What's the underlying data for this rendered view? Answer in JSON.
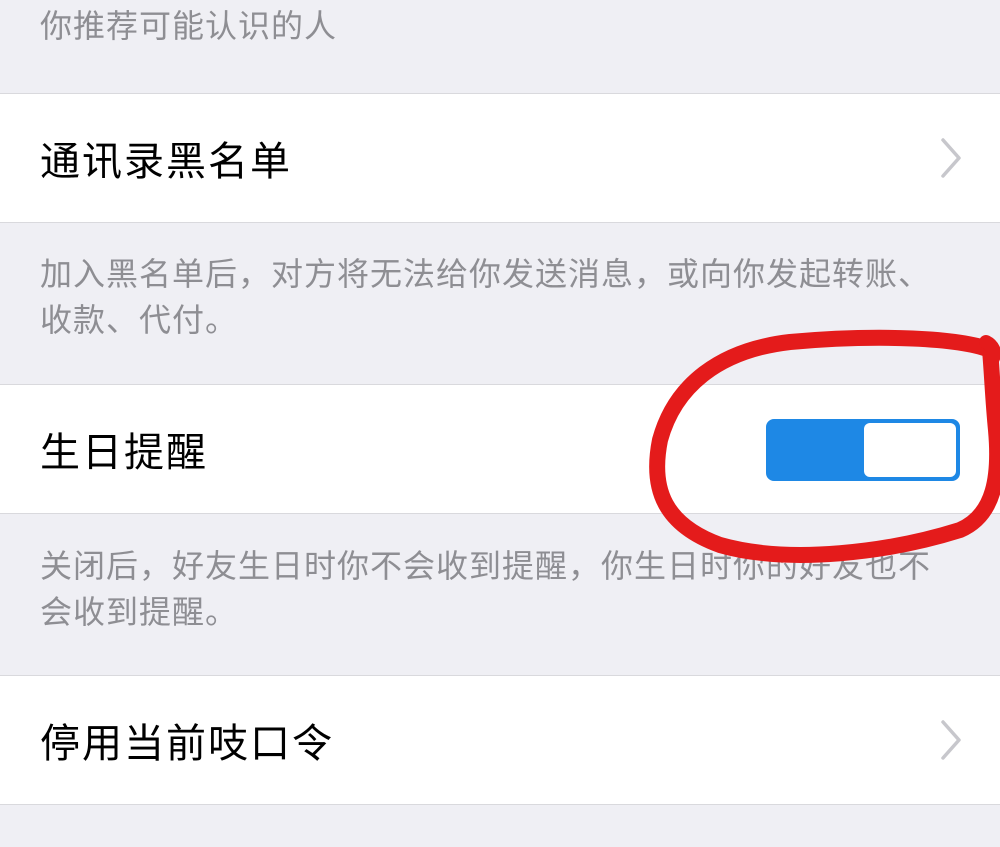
{
  "top_note": "你推荐可能认识的人",
  "blacklist": {
    "label": "通讯录黑名单",
    "icon": "chevron-right-icon",
    "note": "加入黑名单后，对方将无法给你发送消息，或向你发起转账、收款、代付。"
  },
  "birthday": {
    "label": "生日提醒",
    "toggle_on": true,
    "note": "关闭后，好友生日时你不会收到提醒，你生日时你的好友也不会收到提醒。"
  },
  "password": {
    "label": "停用当前吱口令",
    "icon": "chevron-right-icon"
  },
  "colors": {
    "background": "#efeff4",
    "toggle_on": "#1e88e5",
    "annotation": "#e41b1b",
    "note_text": "#8e8e93"
  }
}
